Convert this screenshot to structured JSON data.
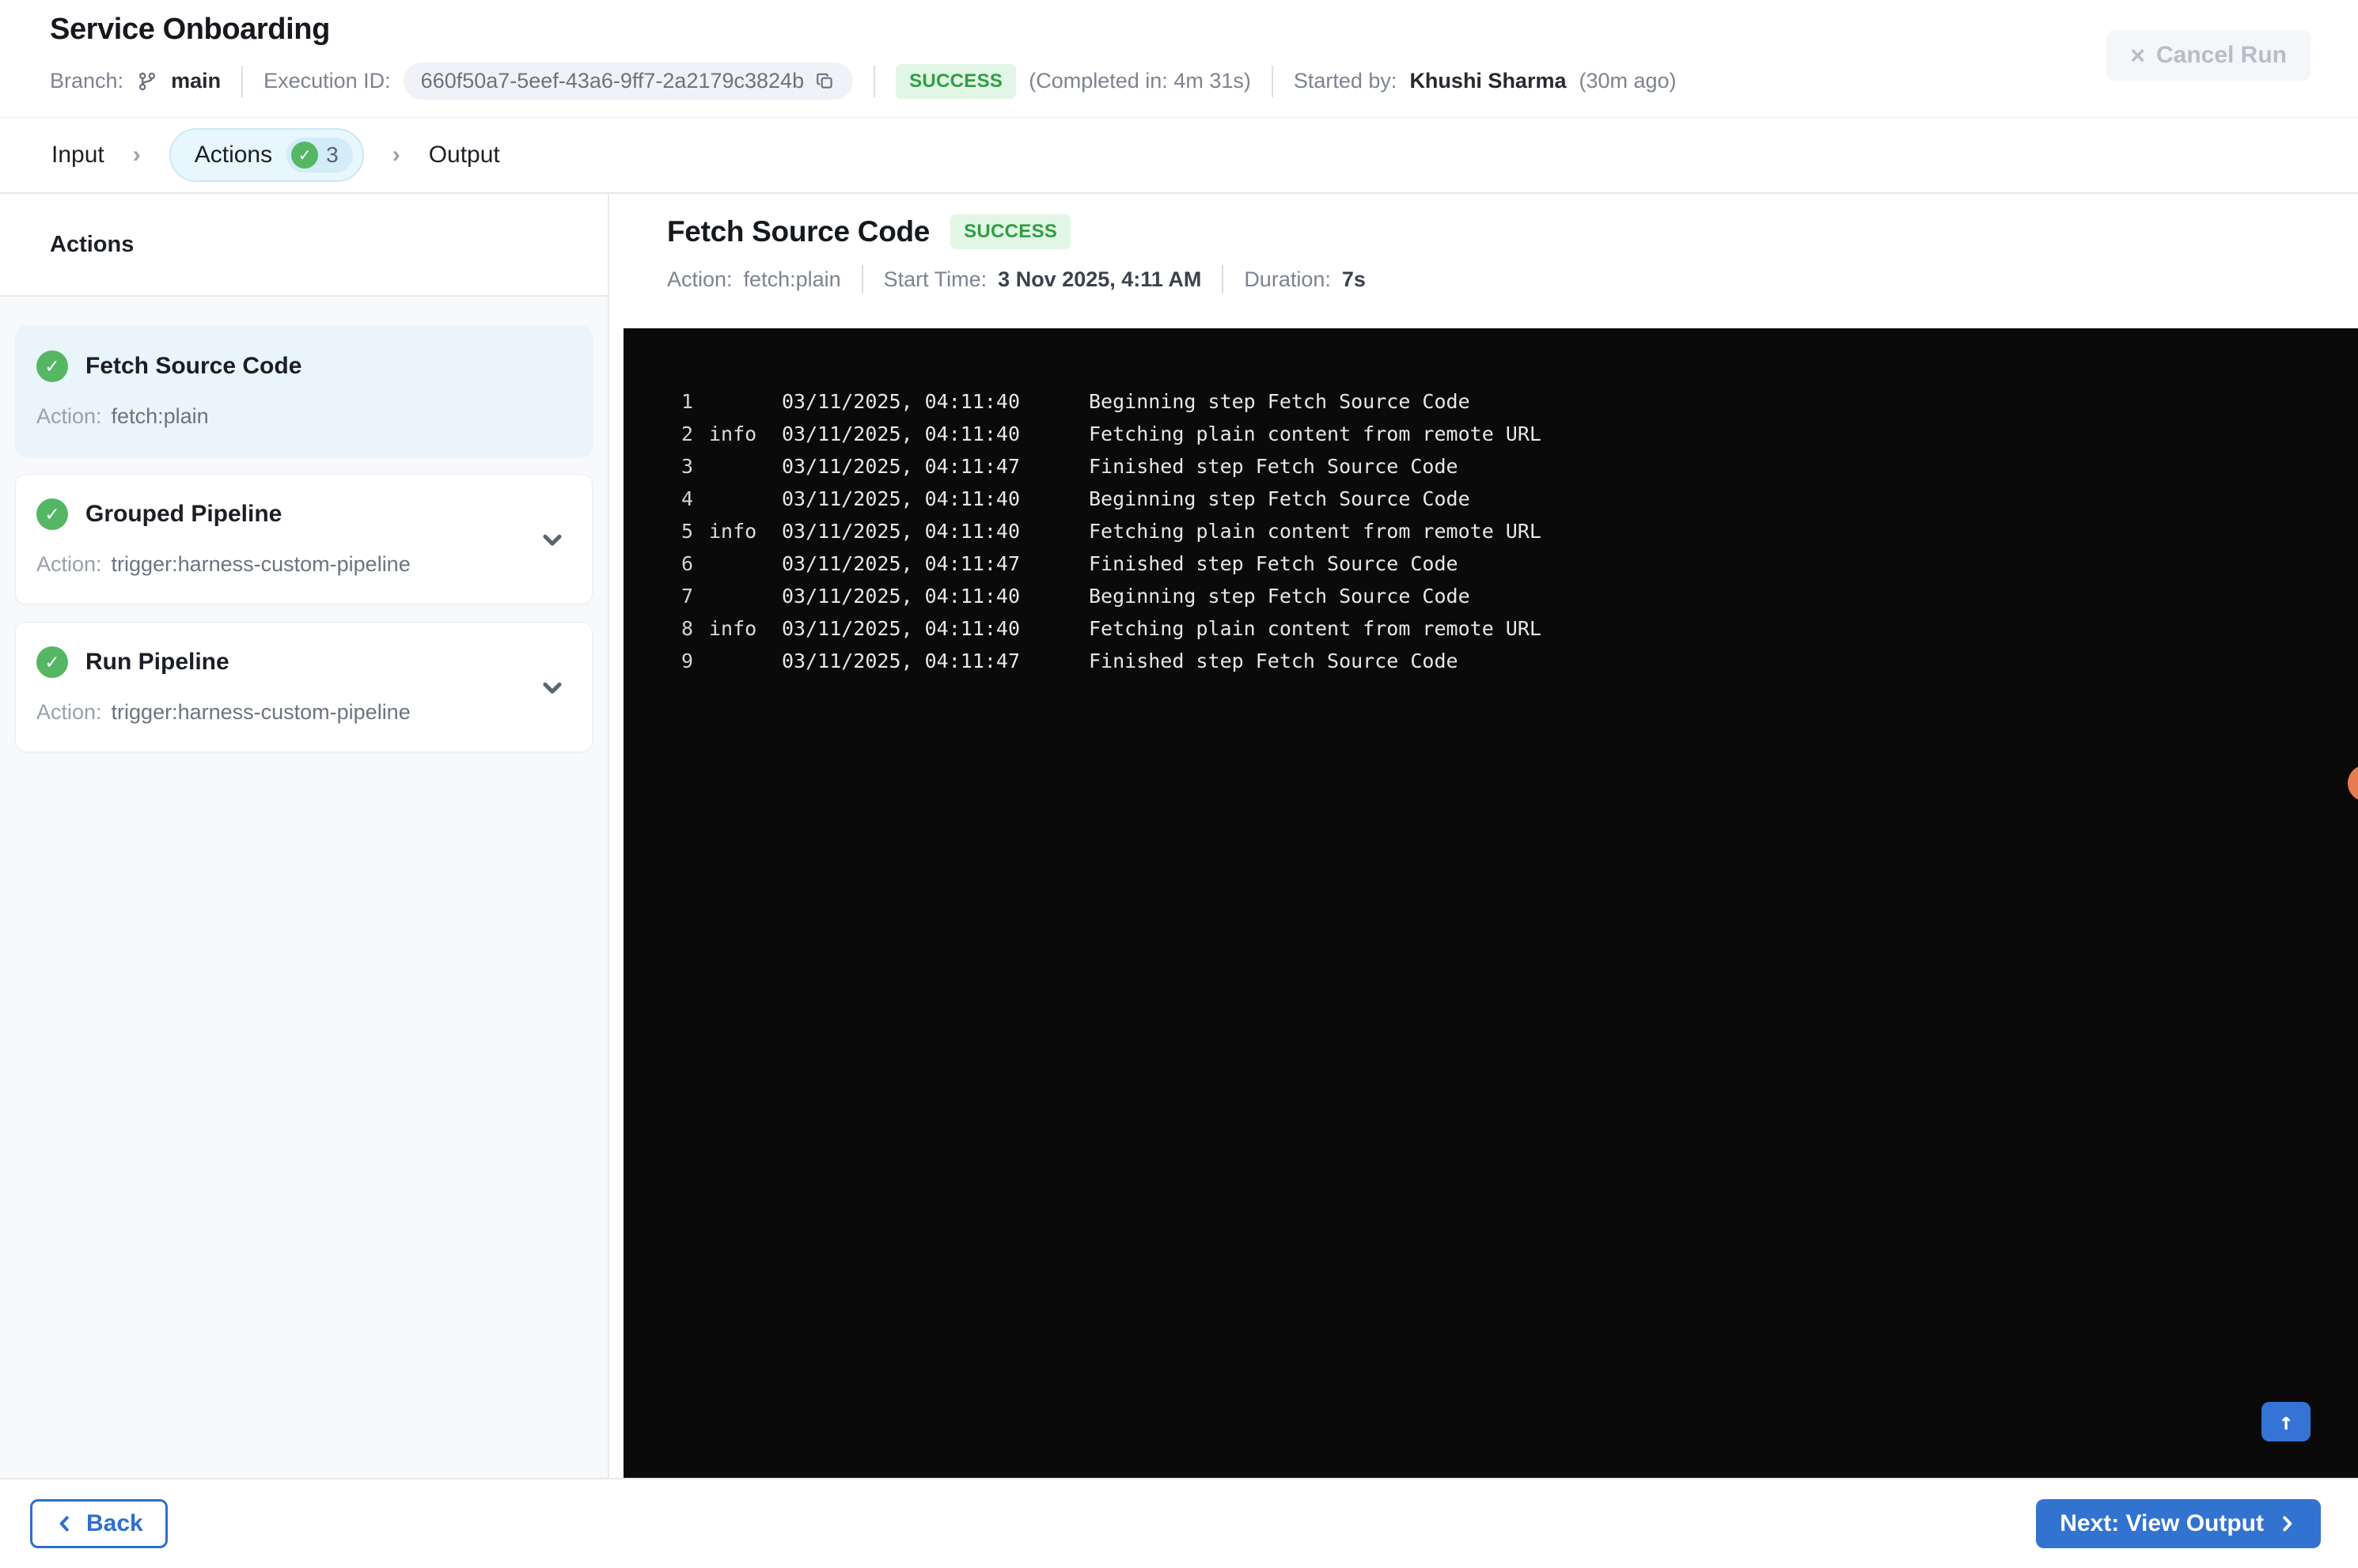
{
  "header": {
    "title": "Service Onboarding",
    "branch_label": "Branch:",
    "branch_name": "main",
    "execution_id_label": "Execution ID:",
    "execution_id": "660f50a7-5eef-43a6-9ff7-2a2179c3824b",
    "status": "SUCCESS",
    "completed_in": "(Completed in: 4m 31s)",
    "started_by_label": "Started by:",
    "started_by_name": "Khushi Sharma",
    "started_by_ago": "(30m ago)",
    "cancel_button": "Cancel Run"
  },
  "stepper": {
    "tabs": [
      {
        "label": "Input",
        "active": false
      },
      {
        "label": "Actions",
        "active": true,
        "count": "3"
      },
      {
        "label": "Output",
        "active": false
      }
    ]
  },
  "sidebar": {
    "heading": "Actions",
    "action_label": "Action:",
    "items": [
      {
        "title": "Fetch Source Code",
        "action": "fetch:plain",
        "selected": true,
        "expandable": false
      },
      {
        "title": "Grouped Pipeline",
        "action": "trigger:harness-custom-pipeline",
        "selected": false,
        "expandable": true
      },
      {
        "title": "Run Pipeline",
        "action": "trigger:harness-custom-pipeline",
        "selected": false,
        "expandable": true
      }
    ]
  },
  "detail": {
    "title": "Fetch Source Code",
    "status": "SUCCESS",
    "meta": {
      "action_label": "Action:",
      "action_value": "fetch:plain",
      "start_label": "Start Time:",
      "start_value": "3 Nov 2025, 4:11 AM",
      "duration_label": "Duration:",
      "duration_value": "7s"
    },
    "logs": [
      {
        "num": "1",
        "level": "",
        "time": "03/11/2025, 04:11:40",
        "message": "Beginning step Fetch Source Code"
      },
      {
        "num": "2",
        "level": "info",
        "time": "03/11/2025, 04:11:40",
        "message": "Fetching plain content from remote URL"
      },
      {
        "num": "3",
        "level": "",
        "time": "03/11/2025, 04:11:47",
        "message": "Finished step Fetch Source Code"
      },
      {
        "num": "4",
        "level": "",
        "time": "03/11/2025, 04:11:40",
        "message": "Beginning step Fetch Source Code"
      },
      {
        "num": "5",
        "level": "info",
        "time": "03/11/2025, 04:11:40",
        "message": "Fetching plain content from remote URL"
      },
      {
        "num": "6",
        "level": "",
        "time": "03/11/2025, 04:11:47",
        "message": "Finished step Fetch Source Code"
      },
      {
        "num": "7",
        "level": "",
        "time": "03/11/2025, 04:11:40",
        "message": "Beginning step Fetch Source Code"
      },
      {
        "num": "8",
        "level": "info",
        "time": "03/11/2025, 04:11:40",
        "message": "Fetching plain content from remote URL"
      },
      {
        "num": "9",
        "level": "",
        "time": "03/11/2025, 04:11:47",
        "message": "Finished step Fetch Source Code"
      }
    ]
  },
  "footer": {
    "back_label": "Back",
    "next_label": "Next: View Output"
  },
  "icons": {
    "close": "×",
    "check": "✓",
    "arrow_up": "↑",
    "chevron_sep": "›"
  },
  "colors": {
    "accent_blue": "#3273d0",
    "success_text": "#2f9e44",
    "success_bg": "#e2f6e5",
    "check_green": "#55b763",
    "console_bg": "#0a0a0b",
    "sidebar_bg": "#f8f9fb",
    "selected_card_bg": "#e9f4fb",
    "tab_pill_bg": "#e8f6fd",
    "orange_dot": "#e97b52"
  }
}
